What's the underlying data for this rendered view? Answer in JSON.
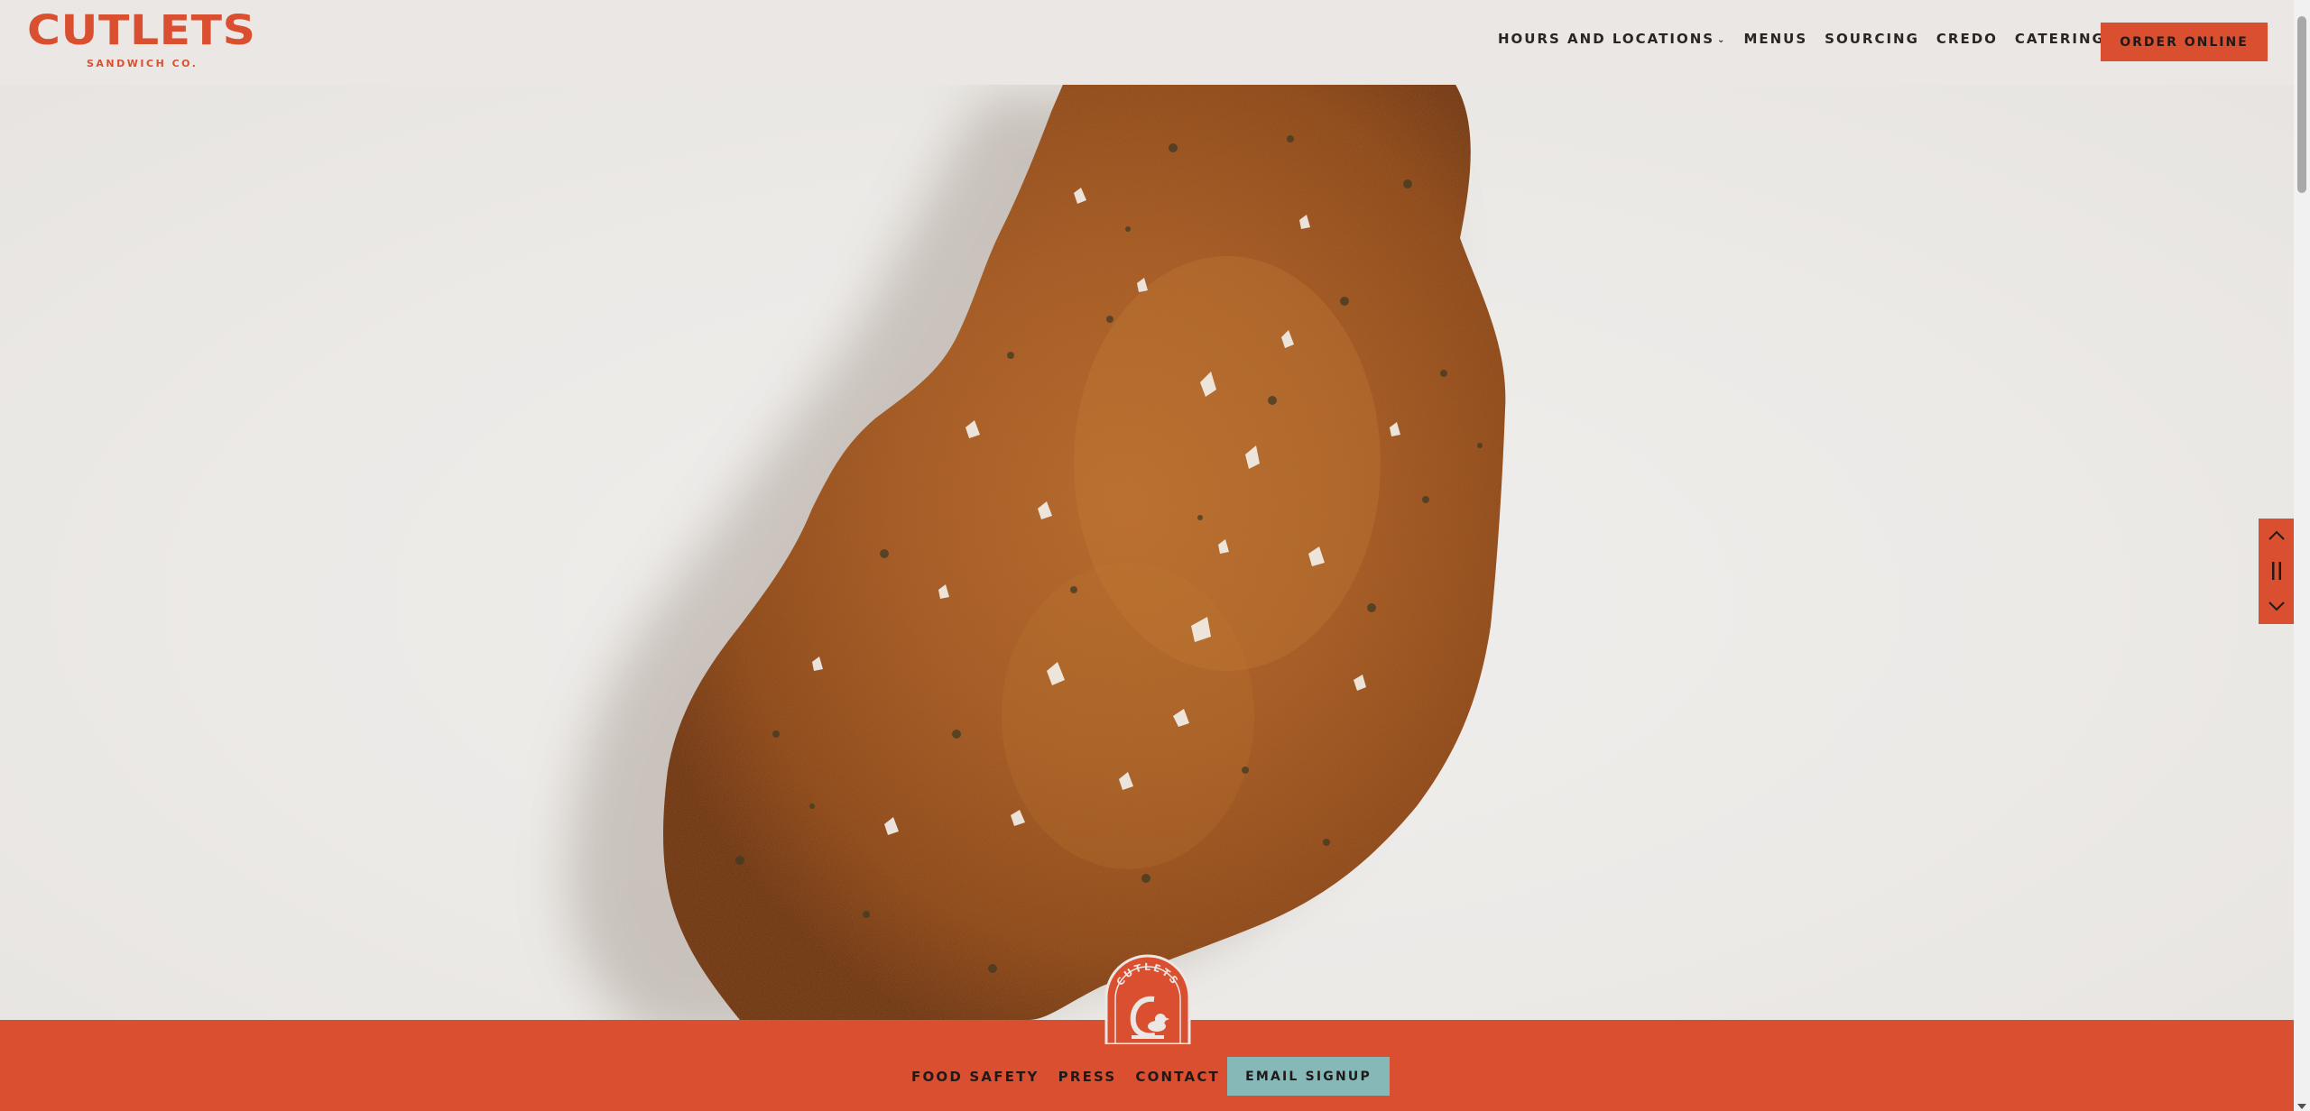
{
  "brand": {
    "name": "CUTLETS",
    "tagline": "SANDWICH CO.",
    "accent_color": "#d94f30",
    "teal_color": "#86b8b8",
    "background_color": "#ebe7e4"
  },
  "nav": {
    "items": [
      {
        "label": "HOURS AND LOCATIONS",
        "has_dropdown": true
      },
      {
        "label": "MENUS"
      },
      {
        "label": "SOURCING"
      },
      {
        "label": "CREDO"
      },
      {
        "label": "CATERING"
      }
    ],
    "order_button": "ORDER ONLINE"
  },
  "hero": {
    "image": "fried-cutlet-photo"
  },
  "slide_controls": {
    "prev_icon": "chevron-up-icon",
    "pause_icon": "pause-icon",
    "next_icon": "chevron-down-icon"
  },
  "badge": {
    "text": "CUTLETS",
    "icon": "chicken-icon"
  },
  "footer": {
    "items": [
      {
        "label": "FOOD SAFETY"
      },
      {
        "label": "PRESS"
      },
      {
        "label": "CONTACT"
      }
    ],
    "email_button": "EMAIL SIGNUP"
  }
}
